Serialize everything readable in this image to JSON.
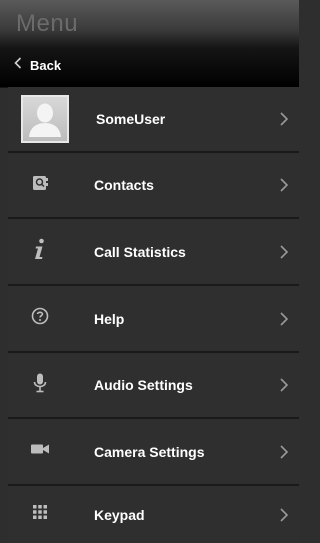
{
  "header": {
    "title": "Menu",
    "back_label": "Back",
    "back_icon": "chevron-left-icon"
  },
  "user": {
    "name": "SomeUser",
    "avatar_icon": "avatar-placeholder-icon"
  },
  "menu": {
    "items": [
      {
        "key": "contacts",
        "label": "Contacts",
        "icon": "contacts-icon"
      },
      {
        "key": "call-statistics",
        "label": "Call Statistics",
        "icon": "info-icon"
      },
      {
        "key": "help",
        "label": "Help",
        "icon": "help-icon"
      },
      {
        "key": "audio-settings",
        "label": "Audio Settings",
        "icon": "microphone-icon"
      },
      {
        "key": "camera-settings",
        "label": "Camera Settings",
        "icon": "camera-icon"
      },
      {
        "key": "keypad",
        "label": "Keypad",
        "icon": "keypad-icon"
      }
    ]
  },
  "colors": {
    "background": "#2e2e2e",
    "divider": "#1a1a1a",
    "text": "#ffffff",
    "title_text": "#6b6b6b",
    "icon": "#bdbdbd",
    "chevron": "#9a9a9a"
  }
}
